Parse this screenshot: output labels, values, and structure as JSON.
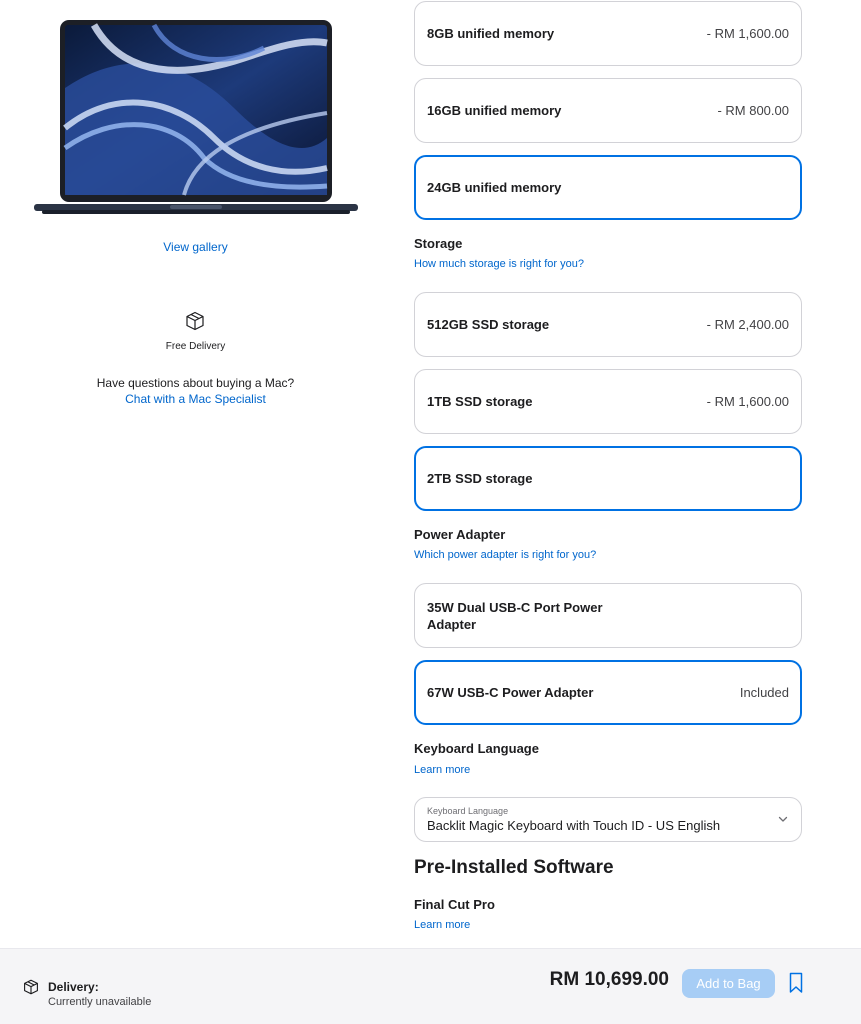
{
  "left": {
    "view_gallery": "View gallery",
    "free_delivery": "Free Delivery",
    "questions": "Have questions about buying a Mac?",
    "chat_link": "Chat with a Mac Specialist"
  },
  "memory": {
    "options": [
      {
        "name": "8GB unified memory",
        "price": "- RM 1,600.00"
      },
      {
        "name": "16GB unified memory",
        "price": "- RM 800.00"
      },
      {
        "name": "24GB unified memory",
        "price": ""
      }
    ]
  },
  "storage": {
    "title": "Storage",
    "link": "How much storage is right for you?",
    "options": [
      {
        "name": "512GB SSD storage",
        "price": "- RM 2,400.00"
      },
      {
        "name": "1TB SSD storage",
        "price": "- RM 1,600.00"
      },
      {
        "name": "2TB SSD storage",
        "price": ""
      }
    ]
  },
  "power": {
    "title": "Power Adapter",
    "link": "Which power adapter is right for you?",
    "options": [
      {
        "name_line1": "35W Dual USB-C Port Power",
        "name_line2": "Adapter",
        "price": ""
      },
      {
        "name": "67W USB-C Power Adapter",
        "price": "Included"
      }
    ]
  },
  "keyboard": {
    "title": "Keyboard Language",
    "link": "Learn more",
    "select_label": "Keyboard Language",
    "select_value": "Backlit Magic Keyboard with Touch ID - US English"
  },
  "software": {
    "title": "Pre-Installed Software",
    "item_title": "Final Cut Pro",
    "link": "Learn more"
  },
  "bottom": {
    "delivery_label": "Delivery:",
    "delivery_status": "Currently unavailable",
    "total": "RM 10,699.00",
    "add_to_bag": "Add to Bag"
  },
  "colors": {
    "accent": "#0071e3",
    "link": "#0066cc",
    "button_disabled": "#a7cdf5"
  },
  "icons": [
    "box-icon",
    "chevron-down-icon",
    "bookmark-icon"
  ]
}
